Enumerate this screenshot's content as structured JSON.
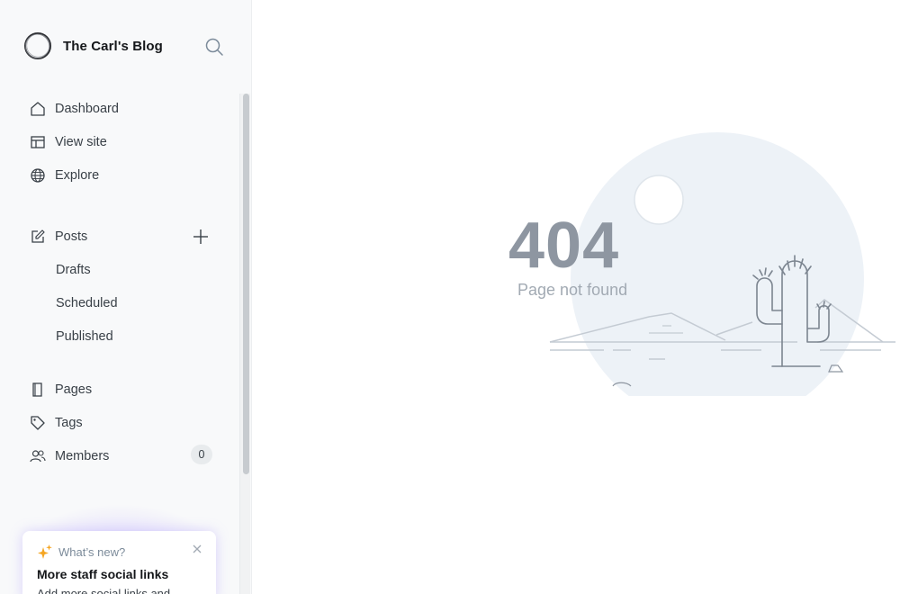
{
  "sidebar": {
    "site_title": "The Carl's Blog",
    "nav": {
      "dashboard": "Dashboard",
      "view_site": "View site",
      "explore": "Explore"
    },
    "posts": {
      "label": "Posts",
      "sub": {
        "drafts": "Drafts",
        "scheduled": "Scheduled",
        "published": "Published"
      }
    },
    "pages": "Pages",
    "tags": "Tags",
    "members": {
      "label": "Members",
      "count": "0"
    },
    "whats_new": {
      "kicker": "What’s new?",
      "title": "More staff social links",
      "body": "Add more social links and"
    }
  },
  "main": {
    "error_code": "404",
    "error_message": "Page not found"
  },
  "colors": {
    "sidebar_bg": "#f8f9fa",
    "text": "#394047",
    "error_code": "#8e96a1",
    "sparkle": "#f5a623",
    "illustration_circle": "#edf2f7"
  },
  "icons": [
    "search-icon",
    "home-icon",
    "layout-icon",
    "globe-icon",
    "edit-icon",
    "plus-icon",
    "page-icon",
    "tag-icon",
    "members-icon",
    "sparkle-icon",
    "close-icon"
  ]
}
